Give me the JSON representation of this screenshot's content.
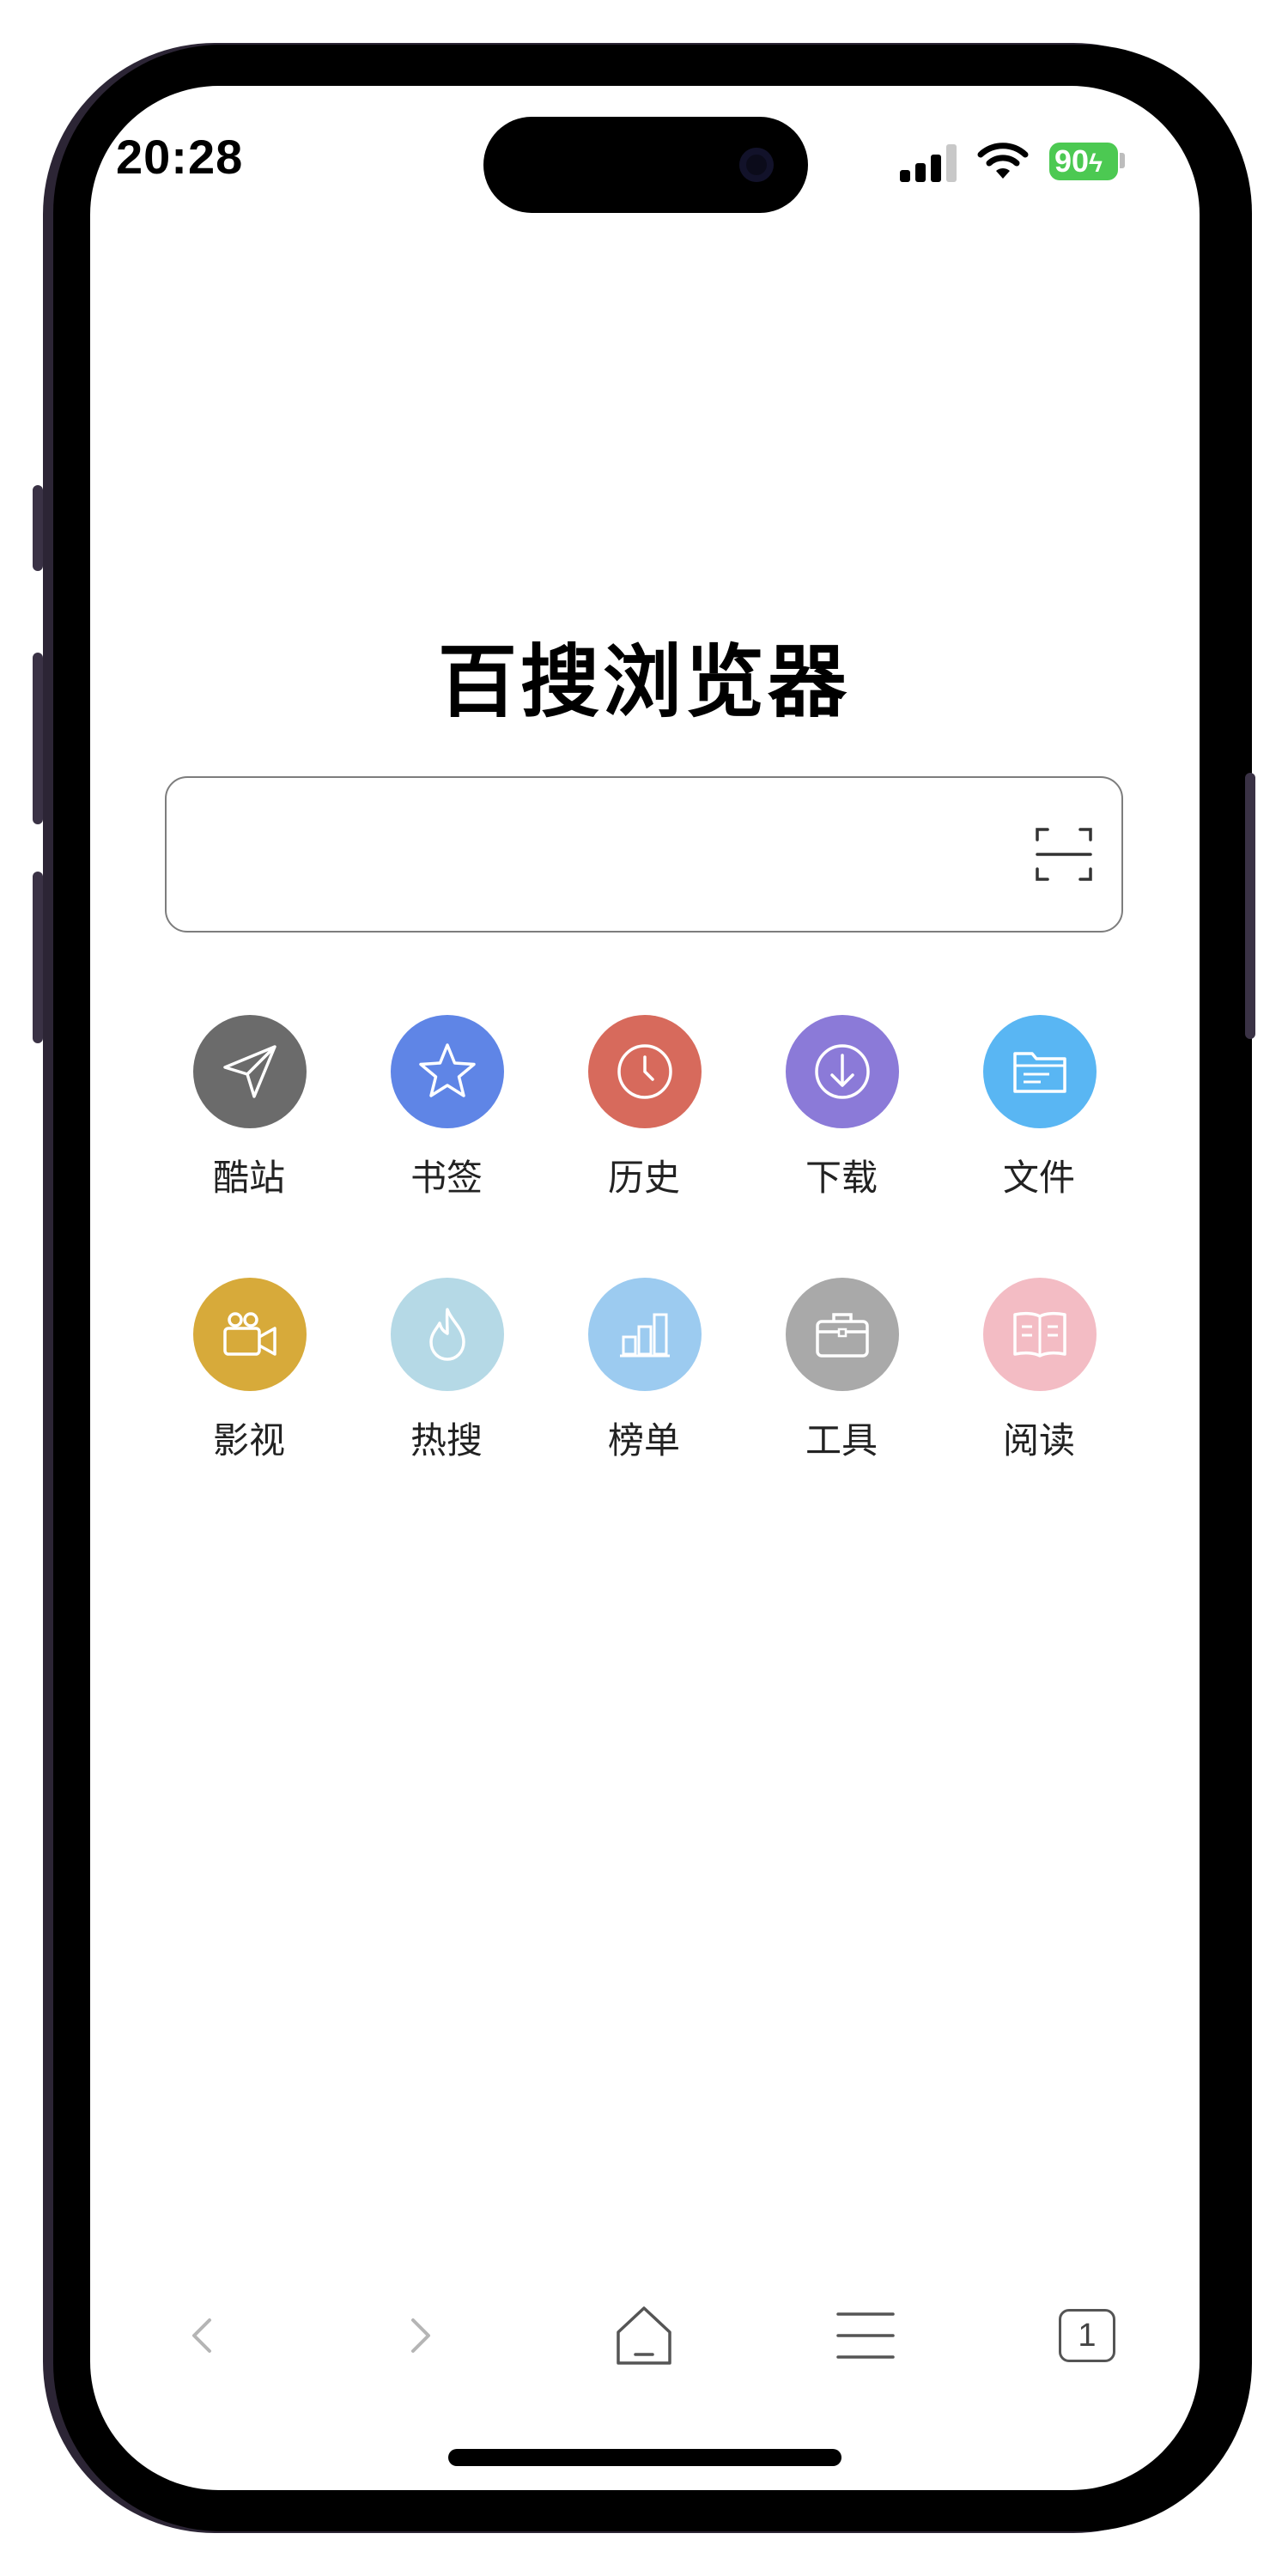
{
  "status_bar": {
    "time": "20:28",
    "battery": "90",
    "battery_color": "#4cc952"
  },
  "app": {
    "title": "百搜浏览器"
  },
  "search": {
    "placeholder": "",
    "value": "",
    "scan_icon": "scan-icon"
  },
  "shortcuts": [
    {
      "label": "酷站",
      "icon": "paper-plane-icon",
      "color": "#6b6b6b"
    },
    {
      "label": "书签",
      "icon": "star-icon",
      "color": "#5f85e6"
    },
    {
      "label": "历史",
      "icon": "clock-icon",
      "color": "#d76a5c"
    },
    {
      "label": "下载",
      "icon": "download-icon",
      "color": "#8b7ad8"
    },
    {
      "label": "文件",
      "icon": "folder-icon",
      "color": "#59b6f3"
    },
    {
      "label": "影视",
      "icon": "video-camera-icon",
      "color": "#d7aa3a"
    },
    {
      "label": "热搜",
      "icon": "flame-icon",
      "color": "#b5d9e6"
    },
    {
      "label": "榜单",
      "icon": "bar-chart-icon",
      "color": "#9ccbf0"
    },
    {
      "label": "工具",
      "icon": "briefcase-icon",
      "color": "#a9a9a9"
    },
    {
      "label": "阅读",
      "icon": "book-icon",
      "color": "#f3bcc4"
    }
  ],
  "bottom_nav": {
    "back_icon": "back-arrow-icon",
    "forward_icon": "forward-arrow-icon",
    "home_icon": "home-icon",
    "menu_icon": "menu-icon",
    "tabs_count": "1"
  }
}
